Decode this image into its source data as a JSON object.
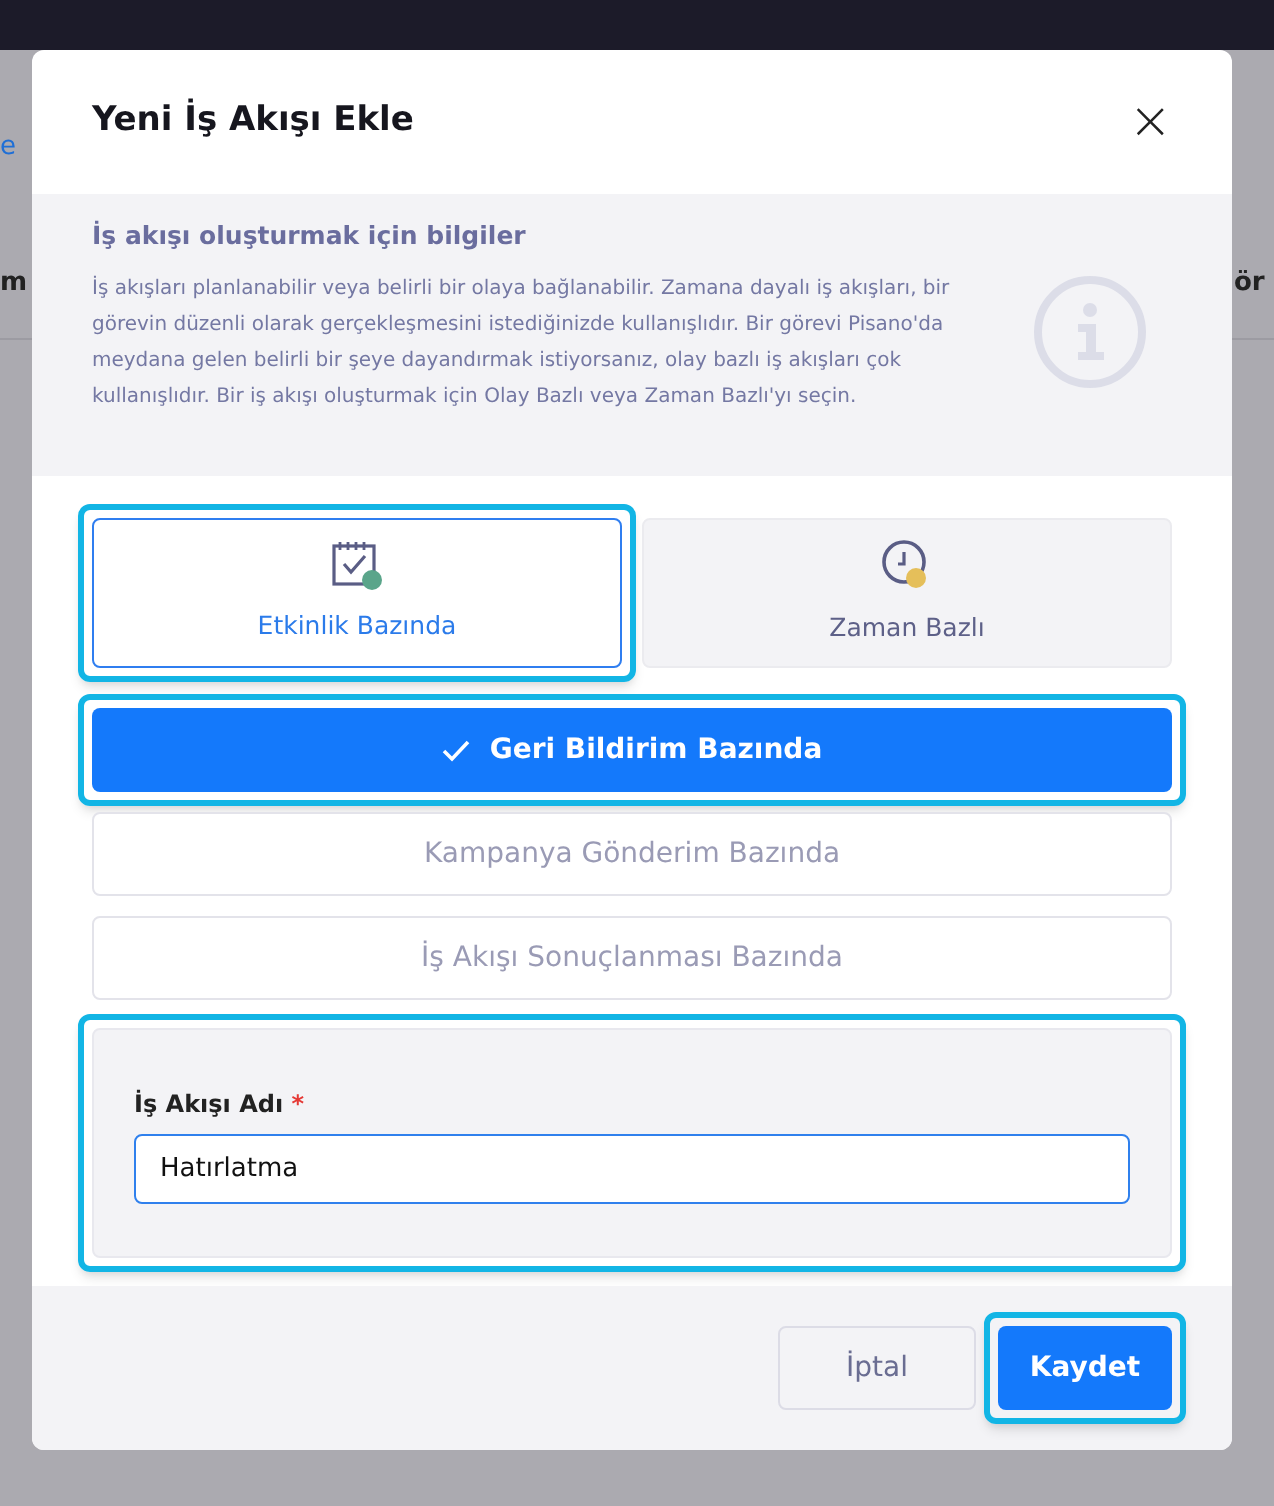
{
  "background": {
    "link_fragment": "e",
    "column_fragments": [
      "m",
      "ör"
    ]
  },
  "dialog": {
    "title": "Yeni İş Akışı Ekle",
    "close": "×",
    "info": {
      "title": "İş akışı oluşturmak için bilgiler",
      "text": "İş akışları planlanabilir veya belirli bir olaya bağlanabilir. Zamana dayalı iş akışları, bir görevin düzenli olarak gerçekleşmesini istediğinizde kullanışlıdır. Bir görevi Pisano'da meydana gelen belirli bir şeye dayandırmak istiyorsanız, olay bazlı iş akışları çok kullanışlıdır. Bir iş akışı oluşturmak için Olay Bazlı veya Zaman Bazlı'yı seçin."
    },
    "trigger_types": [
      {
        "label": "Etkinlik Bazında",
        "kind": "event",
        "selected": true,
        "highlighted": true
      },
      {
        "label": "Zaman Bazlı",
        "kind": "time",
        "selected": false,
        "highlighted": false
      }
    ],
    "event_sources": [
      {
        "label": "Geri Bildirim Bazında",
        "selected": true,
        "highlighted": true
      },
      {
        "label": "Kampanya Gönderim Bazında",
        "selected": false,
        "highlighted": false
      },
      {
        "label": "İş Akışı Sonuçlanması Bazında",
        "selected": false,
        "highlighted": false
      }
    ],
    "name_field": {
      "label": "İş Akışı Adı",
      "required_mark": "*",
      "value": "Hatırlatma",
      "highlighted": true
    },
    "buttons": [
      {
        "label": "İptal",
        "kind": "secondary",
        "highlighted": false
      },
      {
        "label": "Kaydet",
        "kind": "primary",
        "highlighted": true
      }
    ]
  }
}
